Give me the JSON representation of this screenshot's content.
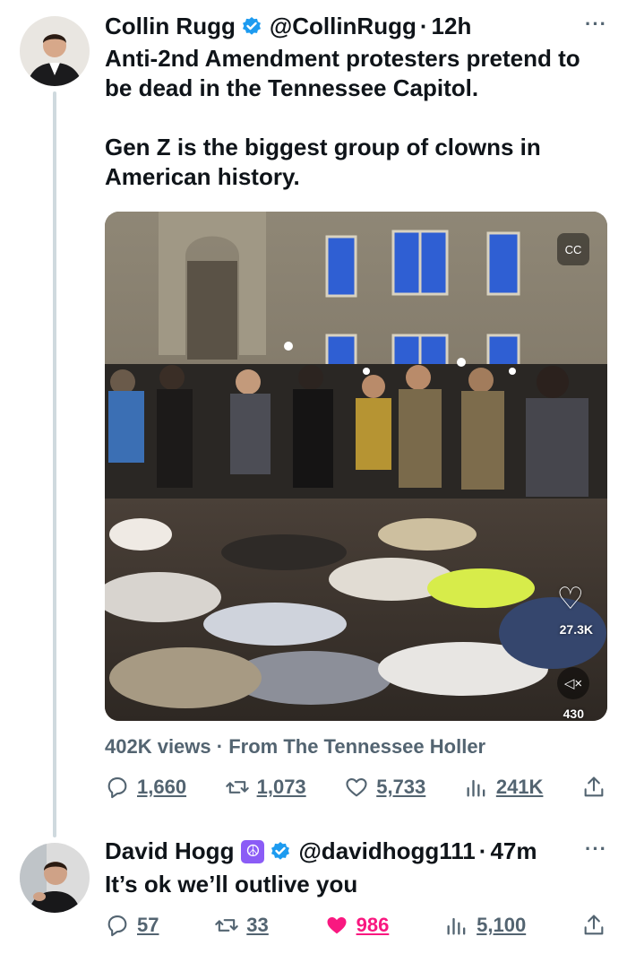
{
  "tweets": [
    {
      "name": "Collin Rugg",
      "handle": "@CollinRugg",
      "time": "12h",
      "text": "Anti-2nd Amendment protesters pretend to be dead in the Tennessee Capitol.\n\nGen Z is the biggest group of clowns in American history.",
      "verified": true,
      "media": {
        "likes": "27.3K",
        "views": "430"
      },
      "views_line": "402K views",
      "source_line": "From The Tennessee Holler",
      "actions": {
        "replies": "1,660",
        "retweets": "1,073",
        "likes": "5,733",
        "views": "241K"
      }
    },
    {
      "name": "David Hogg",
      "emoji": "☮",
      "handle": "@davidhogg111",
      "time": "47m",
      "text": "It’s ok we’ll outlive you",
      "verified": true,
      "actions": {
        "replies": "57",
        "retweets": "33",
        "likes": "986",
        "views": "5,100"
      }
    }
  ],
  "ui": {
    "separator": "·",
    "more": "···",
    "like_color": "#f91880",
    "verified_color": "#1d9bf0"
  }
}
